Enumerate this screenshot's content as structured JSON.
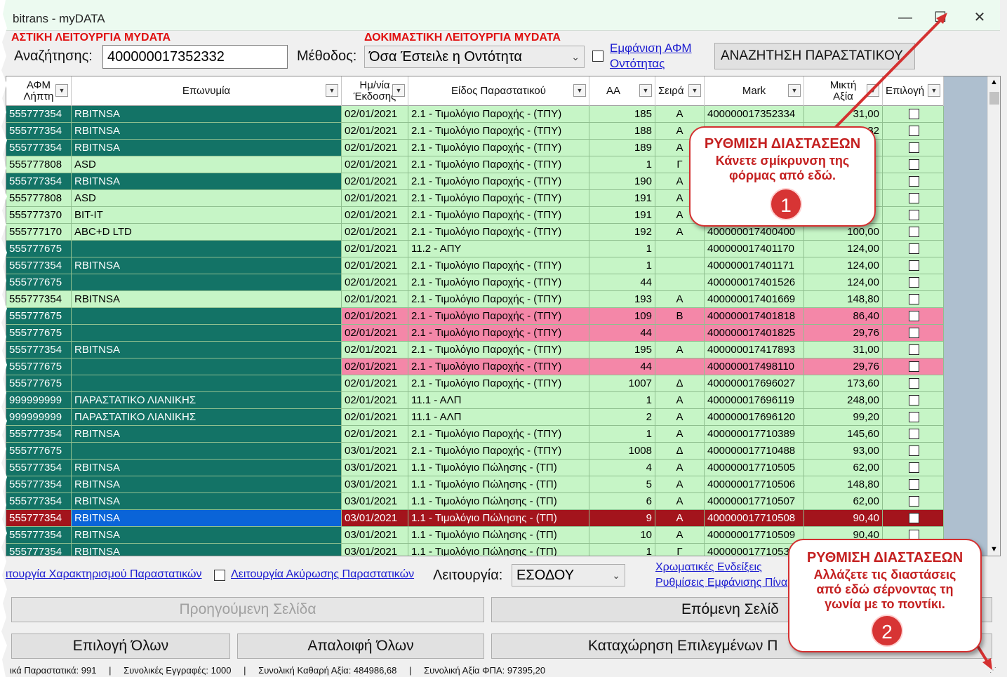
{
  "window": {
    "title": "bitrans - myDATA",
    "minimize": "—",
    "maximize": "☐",
    "close": "✕"
  },
  "top": {
    "test_mode_left": "ΑΣΤΙΚΗ ΛΕΙΤΟΥΡΓΙΑ MYDATA",
    "test_mode_right": "ΔΟΚΙΜΑΣΤΙΚΗ ΛΕΙΤΟΥΡΓΙΑ MYDATA",
    "search_label": "Αναζήτησης:",
    "search_value": "400000017352332",
    "method_label": "Μέθοδος:",
    "method_value": "Όσα Έστειλε η Οντότητα",
    "show_afm_link_line1": "Εμφάνιση ΑΦΜ",
    "show_afm_link_line2": "Οντότητας",
    "search_button": "ΑΝΑΖΗΤΗΣΗ ΠΑΡΑΣΤΑΤΙΚΟΥ"
  },
  "grid": {
    "headers": [
      "ΑΦΜ Λήπτη",
      "Επωνυμία",
      "Ημ/νία Έκδοσης",
      "Είδος Παραστατικού",
      "ΑΑ",
      "Σειρά",
      "Mark",
      "Μικτή Αξία",
      "Επιλογή"
    ],
    "rows": [
      {
        "afm": "555777354",
        "name": "RBITNSA",
        "date": "02/01/2021",
        "type": "2.1 - Τιμολόγιο Παροχής - (ΤΠΥ)",
        "aa": "185",
        "seira": "Α",
        "mark": "400000017352334",
        "value": "31,00",
        "style": "g"
      },
      {
        "afm": "555777354",
        "name": "RBITNSA",
        "date": "02/01/2021",
        "type": "2.1 - Τιμολόγιο Παροχής - (ΤΠΥ)",
        "aa": "188",
        "seira": "Α",
        "mark": "",
        "value": "32",
        "style": "g"
      },
      {
        "afm": "555777354",
        "name": "RBITNSA",
        "date": "02/01/2021",
        "type": "2.1 - Τιμολόγιο Παροχής - (ΤΠΥ)",
        "aa": "189",
        "seira": "Α",
        "mark": "",
        "value": "",
        "style": "g"
      },
      {
        "afm": "555777808",
        "name": "ASD",
        "date": "02/01/2021",
        "type": "2.1 - Τιμολόγιο Παροχής - (ΤΠΥ)",
        "aa": "1",
        "seira": "Γ",
        "mark": "",
        "value": "",
        "style": "l"
      },
      {
        "afm": "555777354",
        "name": "RBITNSA",
        "date": "02/01/2021",
        "type": "2.1 - Τιμολόγιο Παροχής - (ΤΠΥ)",
        "aa": "190",
        "seira": "Α",
        "mark": "",
        "value": "",
        "style": "g"
      },
      {
        "afm": "555777808",
        "name": "ASD",
        "date": "02/01/2021",
        "type": "2.1 - Τιμολόγιο Παροχής - (ΤΠΥ)",
        "aa": "191",
        "seira": "Α",
        "mark": "",
        "value": "",
        "style": "l"
      },
      {
        "afm": "555777370",
        "name": "BIT-IT",
        "date": "02/01/2021",
        "type": "2.1 - Τιμολόγιο Παροχής - (ΤΠΥ)",
        "aa": "191",
        "seira": "Α",
        "mark": "",
        "value": "",
        "style": "l"
      },
      {
        "afm": "555777170",
        "name": "ABC+D LTD",
        "date": "02/01/2021",
        "type": "2.1 - Τιμολόγιο Παροχής - (ΤΠΥ)",
        "aa": "192",
        "seira": "Α",
        "mark": "400000017400400",
        "value": "100,00",
        "style": "l"
      },
      {
        "afm": "555777675",
        "name": "",
        "date": "02/01/2021",
        "type": "11.2 - ΑΠΥ",
        "aa": "1",
        "seira": "",
        "mark": "400000017401170",
        "value": "124,00",
        "style": "g"
      },
      {
        "afm": "555777354",
        "name": "RBITNSA",
        "date": "02/01/2021",
        "type": "2.1 - Τιμολόγιο Παροχής - (ΤΠΥ)",
        "aa": "1",
        "seira": "",
        "mark": "400000017401171",
        "value": "124,00",
        "style": "g"
      },
      {
        "afm": "555777675",
        "name": "",
        "date": "02/01/2021",
        "type": "2.1 - Τιμολόγιο Παροχής - (ΤΠΥ)",
        "aa": "44",
        "seira": "",
        "mark": "400000017401526",
        "value": "124,00",
        "style": "g"
      },
      {
        "afm": "555777354",
        "name": "RBITNSA",
        "date": "02/01/2021",
        "type": "2.1 - Τιμολόγιο Παροχής - (ΤΠΥ)",
        "aa": "193",
        "seira": "Α",
        "mark": "400000017401669",
        "value": "148,80",
        "style": "l"
      },
      {
        "afm": "555777675",
        "name": "",
        "date": "02/01/2021",
        "type": "2.1 - Τιμολόγιο Παροχής - (ΤΠΥ)",
        "aa": "109",
        "seira": "Β",
        "mark": "400000017401818",
        "value": "86,40",
        "style": "p"
      },
      {
        "afm": "555777675",
        "name": "",
        "date": "02/01/2021",
        "type": "2.1 - Τιμολόγιο Παροχής - (ΤΠΥ)",
        "aa": "44",
        "seira": "",
        "mark": "400000017401825",
        "value": "29,76",
        "style": "p"
      },
      {
        "afm": "555777354",
        "name": "RBITNSA",
        "date": "02/01/2021",
        "type": "2.1 - Τιμολόγιο Παροχής - (ΤΠΥ)",
        "aa": "195",
        "seira": "Α",
        "mark": "400000017417893",
        "value": "31,00",
        "style": "g"
      },
      {
        "afm": "555777675",
        "name": "",
        "date": "02/01/2021",
        "type": "2.1 - Τιμολόγιο Παροχής - (ΤΠΥ)",
        "aa": "44",
        "seira": "",
        "mark": "400000017498110",
        "value": "29,76",
        "style": "p"
      },
      {
        "afm": "555777675",
        "name": "",
        "date": "02/01/2021",
        "type": "2.1 - Τιμολόγιο Παροχής - (ΤΠΥ)",
        "aa": "1007",
        "seira": "Δ",
        "mark": "400000017696027",
        "value": "173,60",
        "style": "g"
      },
      {
        "afm": "999999999",
        "name": "ΠΑΡΑΣΤΑΤΙΚΟ ΛΙΑΝΙΚΗΣ",
        "date": "02/01/2021",
        "type": "11.1 - ΑΛΠ",
        "aa": "1",
        "seira": "Α",
        "mark": "400000017696119",
        "value": "248,00",
        "style": "g"
      },
      {
        "afm": "999999999",
        "name": "ΠΑΡΑΣΤΑΤΙΚΟ ΛΙΑΝΙΚΗΣ",
        "date": "02/01/2021",
        "type": "11.1 - ΑΛΠ",
        "aa": "2",
        "seira": "Α",
        "mark": "400000017696120",
        "value": "99,20",
        "style": "g"
      },
      {
        "afm": "555777354",
        "name": "RBITNSA",
        "date": "02/01/2021",
        "type": "2.1 - Τιμολόγιο Παροχής - (ΤΠΥ)",
        "aa": "1",
        "seira": "Α",
        "mark": "400000017710389",
        "value": "145,60",
        "style": "g"
      },
      {
        "afm": "555777675",
        "name": "",
        "date": "03/01/2021",
        "type": "2.1 - Τιμολόγιο Παροχής - (ΤΠΥ)",
        "aa": "1008",
        "seira": "Δ",
        "mark": "400000017710488",
        "value": "93,00",
        "style": "g"
      },
      {
        "afm": "555777354",
        "name": "RBITNSA",
        "date": "03/01/2021",
        "type": "1.1 - Τιμολόγιο Πώλησης - (ΤΠ)",
        "aa": "4",
        "seira": "Α",
        "mark": "400000017710505",
        "value": "62,00",
        "style": "g"
      },
      {
        "afm": "555777354",
        "name": "RBITNSA",
        "date": "03/01/2021",
        "type": "1.1 - Τιμολόγιο Πώλησης - (ΤΠ)",
        "aa": "5",
        "seira": "Α",
        "mark": "400000017710506",
        "value": "148,80",
        "style": "g"
      },
      {
        "afm": "555777354",
        "name": "RBITNSA",
        "date": "03/01/2021",
        "type": "1.1 - Τιμολόγιο Πώλησης - (ΤΠ)",
        "aa": "6",
        "seira": "Α",
        "mark": "400000017710507",
        "value": "62,00",
        "style": "g"
      },
      {
        "afm": "555777354",
        "name": "RBITNSA",
        "date": "03/01/2021",
        "type": "1.1 - Τιμολόγιο Πώλησης - (ΤΠ)",
        "aa": "9",
        "seira": "Α",
        "mark": "400000017710508",
        "value": "90,40",
        "style": "s"
      },
      {
        "afm": "555777354",
        "name": "RBITNSA",
        "date": "03/01/2021",
        "type": "1.1 - Τιμολόγιο Πώλησης - (ΤΠ)",
        "aa": "10",
        "seira": "Α",
        "mark": "400000017710509",
        "value": "90,40",
        "style": "g"
      },
      {
        "afm": "555777354",
        "name": "RBITNSA",
        "date": "03/01/2021",
        "type": "1.1 - Τιμολόγιο Πώλησης - (ΤΠ)",
        "aa": "1",
        "seira": "Γ",
        "mark": "400000017710530",
        "value": "",
        "style": "g"
      }
    ]
  },
  "bottom": {
    "char_link": "ιτουργία Χαρακτηρισμού Παραστατικών",
    "cancel_link": "Λειτουργία Ακύρωσης Παραστατικών",
    "mode_label": "Λειτουργία:",
    "mode_value": "ΕΣΟΔΟΥ",
    "color_link": "Χρωματικές Ενδείξεις",
    "settings_link": "Ρυθμίσεις Εμφάνισης Πίνα",
    "prev_page": "Προηγούμενη Σελίδα",
    "next_page": "Επόμενη Σελίδ",
    "select_all": "Επιλογή Όλων",
    "deselect_all": "Απαλοιφή Όλων",
    "submit_selected": "Καταχώρηση Επιλεγμένων Π"
  },
  "status": {
    "total_docs": "ικά Παραστατικά: 991",
    "total_records": "Συνολικές Εγγραφές: 1000",
    "net_value": "Συνολική Καθαρή Αξία: 484986,68",
    "vat_value": "Συνολική Αξία ΦΠΑ: 97395,20"
  },
  "callouts": {
    "c1_title": "ΡΥΘΜΙΣΗ ΔΙΑΣΤΑΣΕΩΝ",
    "c1_text1": "Κάνετε σμίκρυνση της",
    "c1_text2": "φόρμας από εδώ.",
    "c1_num": "1",
    "c2_title": "ΡΥΘΜΙΣΗ ΔΙΑΣΤΑΣΕΩΝ",
    "c2_text1": "Αλλάζετε τις διαστάσεις",
    "c2_text2": "από εδώ σέρνοντας τη",
    "c2_text3": "γωνία με το ποντίκι.",
    "c2_num": "2"
  },
  "colors": {
    "dark_teal": "#137366",
    "light_green": "#c6f5c6",
    "pink": "#f487a8",
    "selected_red": "#a3141c",
    "selected_blue": "#0a64d8",
    "callout_red": "#d43030"
  }
}
